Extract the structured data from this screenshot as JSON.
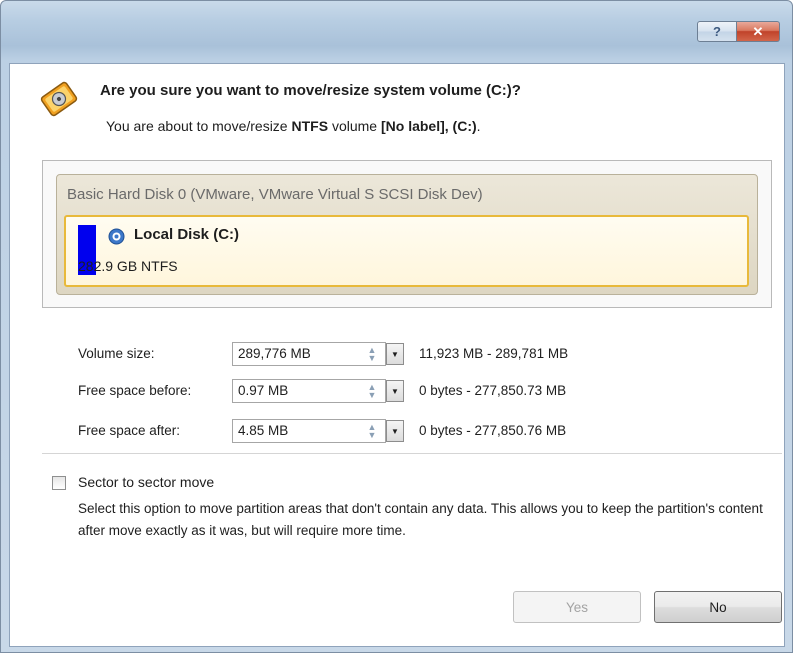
{
  "titlebar": {
    "help_label": "?",
    "close_label": "✕"
  },
  "header": {
    "question": "Are you sure you want to move/resize system volume (C:)?",
    "sub_prefix": "You are about to move/resize ",
    "sub_fs": "NTFS",
    "sub_middle": " volume ",
    "sub_label": "[No label], (C:)",
    "sub_suffix": "."
  },
  "disk": {
    "title": "Basic Hard Disk 0 (VMware, VMware Virtual S SCSI Disk Dev)",
    "volume": {
      "name": "Local Disk (C:)",
      "details": "282.9 GB NTFS",
      "color": "#0000ee"
    }
  },
  "fields": [
    {
      "label": "Volume size:",
      "value": "289,776 MB",
      "range": "11,923 MB - 289,781 MB"
    },
    {
      "label": "Free space before:",
      "value": "0.97 MB",
      "range": "0 bytes - 277,850.73 MB"
    },
    {
      "label": "Free space after:",
      "value": "4.85 MB",
      "range": "0 bytes - 277,850.76 MB"
    }
  ],
  "option": {
    "label": "Sector to sector move",
    "checked": false,
    "description": "Select this option to move partition areas that don't contain any data. This allows you to keep the partition's content after move exactly as it was, but will require more time."
  },
  "buttons": {
    "yes": "Yes",
    "no": "No"
  }
}
